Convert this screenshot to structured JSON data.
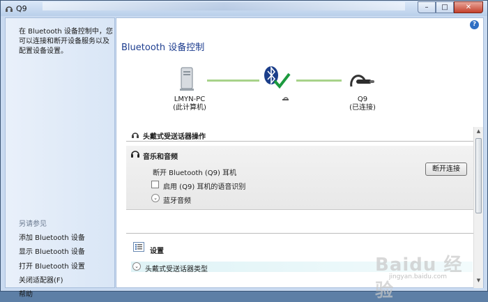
{
  "window": {
    "title": "Q9",
    "controls": {
      "minimize": "–",
      "maximize": "□",
      "close": "✕"
    },
    "help": "?"
  },
  "sidebar": {
    "description": "在 Bluetooth 设备控制中，您可以连接和断开设备服务以及配置设备设置。",
    "see_also": "另请参见",
    "links": [
      "添加 Bluetooth 设备",
      "显示 Bluetooth 设备",
      "打开 Bluetooth 设置",
      "关闭适配器(F)",
      "帮助"
    ]
  },
  "main": {
    "title": "Bluetooth 设备控制",
    "computer": {
      "name": "LMYN-PC",
      "sub": "(此计算机)"
    },
    "device": {
      "name": "Q9",
      "sub": "(已连接)"
    },
    "section_title": "头戴式受送话器操作",
    "music": {
      "heading": "音乐和音频",
      "disconnect_text": "断开 Bluetooth (Q9) 耳机",
      "voice_recognition": "启用 (Q9) 耳机的语音识别",
      "voice_recognition_checked": false,
      "bluetooth_audio": "蓝牙音频",
      "disconnect_button": "断开连接"
    },
    "settings": {
      "title": "设置",
      "headset_type": "头戴式受送话器类型"
    }
  },
  "watermark": {
    "brand": "Baidu 经验",
    "sub": "jingyan.baidu.com"
  },
  "colors": {
    "accent_title": "#1d3d8f",
    "link_green": "#a8d28a",
    "check_green": "#1c9a3e",
    "bluetooth_blue": "#1b3e8a"
  }
}
